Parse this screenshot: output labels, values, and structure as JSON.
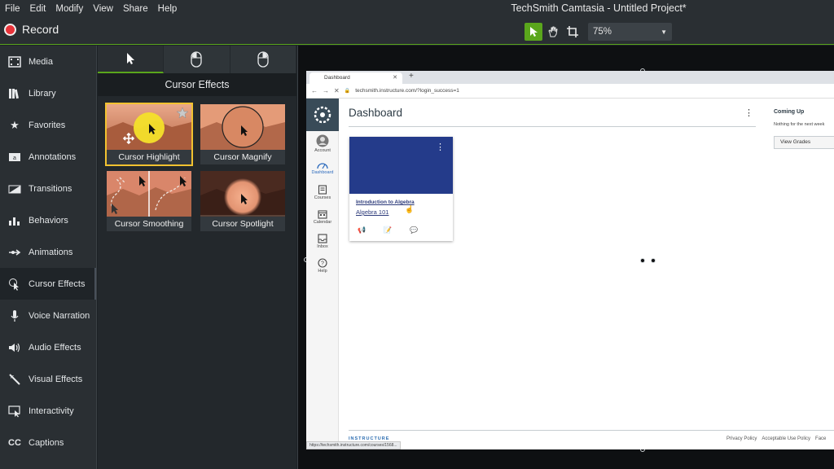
{
  "menu": [
    "File",
    "Edit",
    "Modify",
    "View",
    "Share",
    "Help"
  ],
  "app_title": "TechSmith Camtasia - Untitled Project*",
  "toolbar": {
    "record_label": "Record",
    "zoom_value": "75%"
  },
  "sidebar": {
    "items": [
      {
        "label": "Media",
        "icon": "film-icon"
      },
      {
        "label": "Library",
        "icon": "library-icon"
      },
      {
        "label": "Favorites",
        "icon": "star-icon"
      },
      {
        "label": "Annotations",
        "icon": "annotation-icon"
      },
      {
        "label": "Transitions",
        "icon": "transition-icon"
      },
      {
        "label": "Behaviors",
        "icon": "behaviors-icon"
      },
      {
        "label": "Animations",
        "icon": "animation-arrow-icon"
      },
      {
        "label": "Cursor Effects",
        "icon": "cursor-effects-icon"
      },
      {
        "label": "Voice Narration",
        "icon": "microphone-icon"
      },
      {
        "label": "Audio Effects",
        "icon": "speaker-icon"
      },
      {
        "label": "Visual Effects",
        "icon": "magic-wand-icon"
      },
      {
        "label": "Interactivity",
        "icon": "interactivity-icon"
      },
      {
        "label": "Captions",
        "icon": "cc-icon"
      }
    ],
    "active_index": 7
  },
  "panel": {
    "title": "Cursor Effects",
    "effects": [
      "Cursor Highlight",
      "Cursor Magnify",
      "Cursor Smoothing",
      "Cursor Spotlight"
    ]
  },
  "canvas": {
    "tab_label": "Dashboard",
    "url": "techsmith.instructure.com/?login_success=1",
    "sidebar": [
      "Account",
      "Dashboard",
      "Courses",
      "Calendar",
      "Inbox",
      "Help"
    ],
    "page_title": "Dashboard",
    "course_title": "Introduction to Algebra",
    "course_sub": "Algebra 101",
    "coming_up": "Coming Up",
    "coming_note": "Nothing for the next week",
    "view_grades": "View Grades",
    "footer_logo": "INSTRUCTURE",
    "footer_links": [
      "Privacy Policy",
      "Acceptable Use Policy",
      "Face"
    ],
    "status_url": "https://techsmith.instructure.com/courses/1568..."
  },
  "colors": {
    "accent": "#5aa61c",
    "record": "#e8333a",
    "selected": "#f2c230",
    "course": "#243b8a"
  }
}
